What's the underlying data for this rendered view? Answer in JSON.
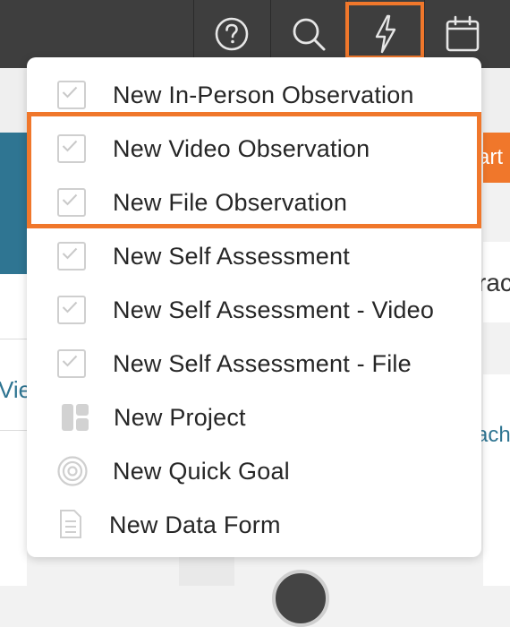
{
  "topbar": {
    "buttons": [
      {
        "name": "help",
        "icon": "question-circle-icon"
      },
      {
        "name": "search",
        "icon": "search-icon"
      },
      {
        "name": "quick-actions",
        "icon": "lightning-icon",
        "highlighted": true
      },
      {
        "name": "calendar",
        "icon": "calendar-icon"
      }
    ]
  },
  "colors": {
    "accent_orange": "#f0772b",
    "teal": "#2f7592",
    "topbar": "#3e3e3e"
  },
  "background": {
    "left_link": "Vie",
    "right_button": "art",
    "right_title": "rac",
    "right_link": "ach"
  },
  "menu": {
    "items": [
      {
        "label": "New In-Person Observation",
        "icon": "checkbox-icon"
      },
      {
        "label": "New Video Observation",
        "icon": "checkbox-icon",
        "highlighted": true
      },
      {
        "label": "New File Observation",
        "icon": "checkbox-icon",
        "highlighted": true
      },
      {
        "label": "New Self Assessment",
        "icon": "checkbox-icon"
      },
      {
        "label": "New Self Assessment - Video",
        "icon": "checkbox-icon"
      },
      {
        "label": "New Self Assessment - File",
        "icon": "checkbox-icon"
      },
      {
        "label": "New Project",
        "icon": "project-icon"
      },
      {
        "label": "New Quick Goal",
        "icon": "target-icon"
      },
      {
        "label": "New Data Form",
        "icon": "form-icon"
      }
    ]
  }
}
